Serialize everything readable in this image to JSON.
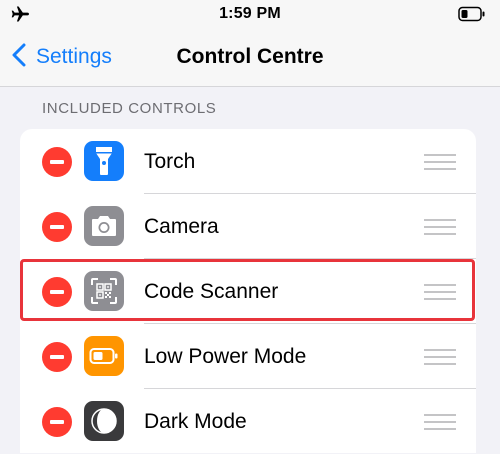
{
  "status_bar": {
    "time": "1:59 PM"
  },
  "nav": {
    "back_label": "Settings",
    "title": "Control Centre"
  },
  "section": {
    "header": "INCLUDED CONTROLS"
  },
  "controls": [
    {
      "label": "Torch",
      "icon": "torch-icon",
      "color": "#147efb"
    },
    {
      "label": "Camera",
      "icon": "camera-icon",
      "color": "#8e8e93"
    },
    {
      "label": "Code Scanner",
      "icon": "qr-code-icon",
      "color": "#8e8e93",
      "highlighted": true
    },
    {
      "label": "Low Power Mode",
      "icon": "battery-icon",
      "color": "#ff9500"
    },
    {
      "label": "Dark Mode",
      "icon": "dark-mode-icon",
      "color": "#3a3a3c"
    }
  ],
  "colors": {
    "accent": "#147efb",
    "remove": "#ff3b30",
    "highlight": "#e8343b"
  }
}
